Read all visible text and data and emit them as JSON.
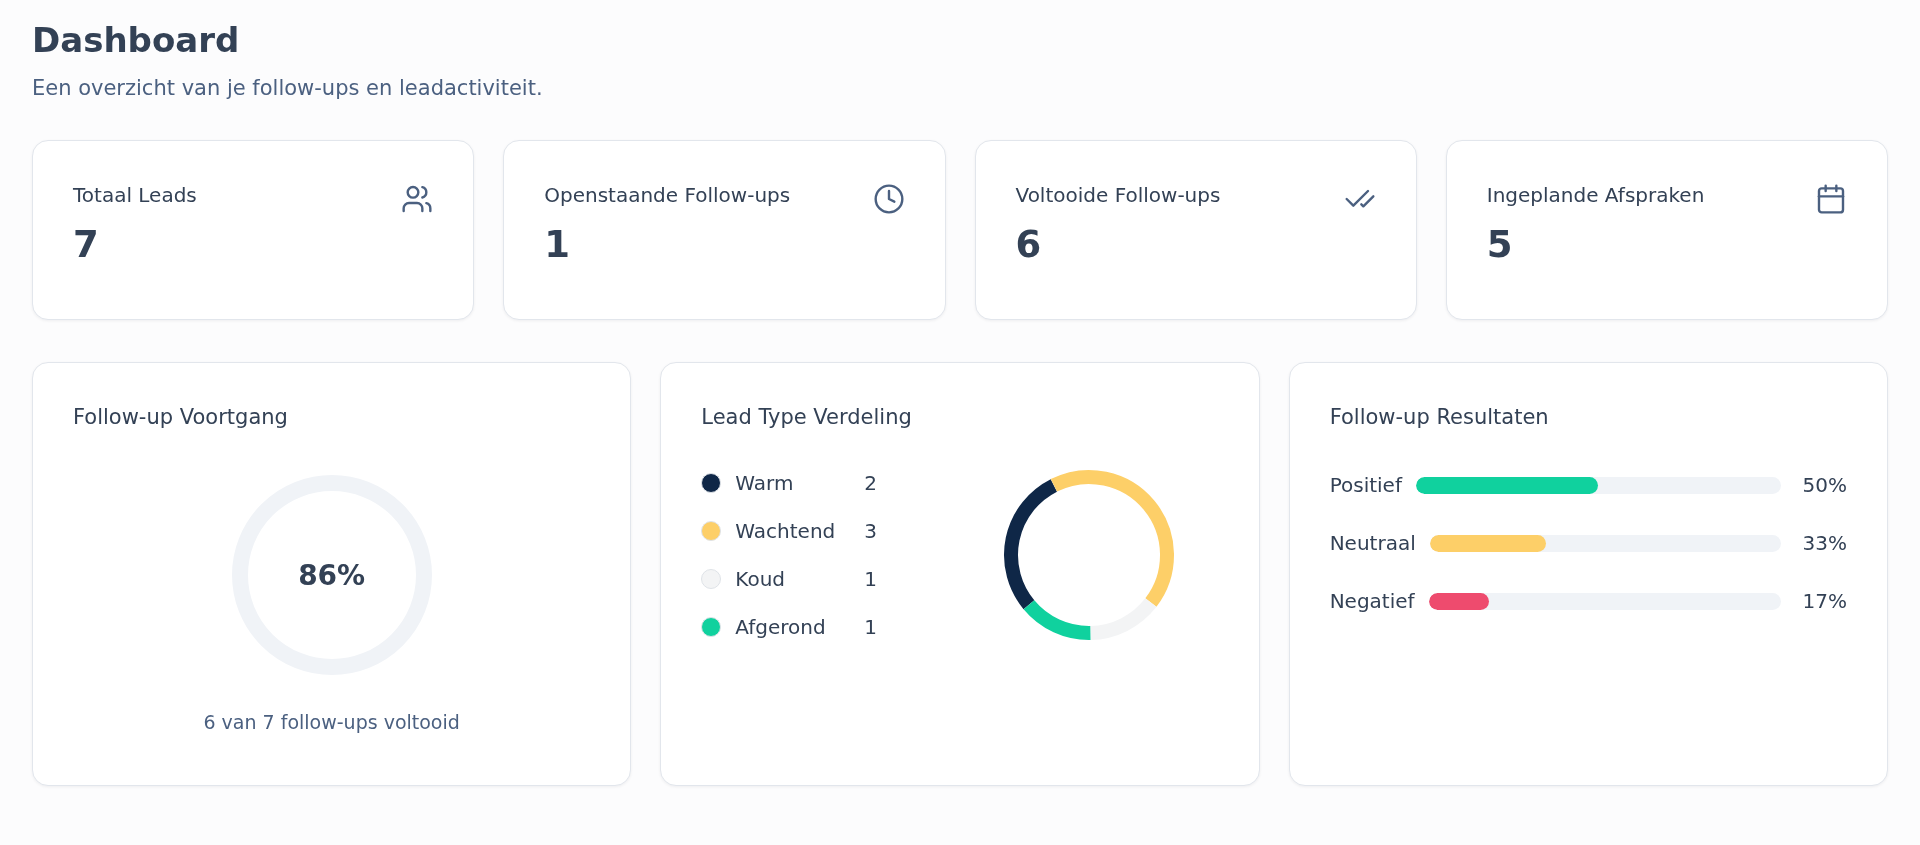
{
  "header": {
    "title": "Dashboard",
    "subtitle": "Een overzicht van je follow-ups en leadactiviteit."
  },
  "stats": [
    {
      "label": "Totaal Leads",
      "value": "7"
    },
    {
      "label": "Openstaande Follow-ups",
      "value": "1"
    },
    {
      "label": "Voltooide Follow-ups",
      "value": "6"
    },
    {
      "label": "Ingeplande Afspraken",
      "value": "5"
    }
  ],
  "progress": {
    "title": "Follow-up Voortgang",
    "percent": "86%",
    "caption": "6 van 7 follow-ups voltooid"
  },
  "lead_types": {
    "title": "Lead Type Verdeling",
    "items": [
      {
        "name": "Warm",
        "count": "2",
        "color": "#0f2747"
      },
      {
        "name": "Wachtend",
        "count": "3",
        "color": "#fdcf68"
      },
      {
        "name": "Koud",
        "count": "1",
        "color": "#f3f4f5"
      },
      {
        "name": "Afgerond",
        "count": "1",
        "color": "#10d19e"
      }
    ]
  },
  "results": {
    "title": "Follow-up Resultaten",
    "items": [
      {
        "name": "Positief",
        "level": 0.5,
        "reading": "50%",
        "color": "#10d19e"
      },
      {
        "name": "Neutraal",
        "level": 0.33,
        "reading": "33%",
        "color": "#fdcf68"
      },
      {
        "name": "Negatief",
        "level": 0.17,
        "reading": "17%",
        "color": "#ee4b6e"
      }
    ]
  }
}
